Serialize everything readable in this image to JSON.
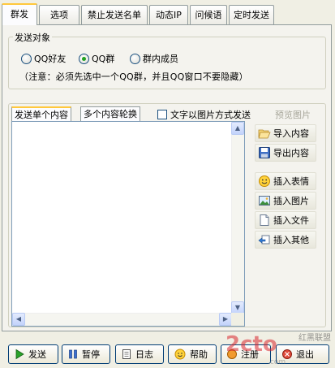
{
  "tabs": [
    "群发",
    "选项",
    "禁止发送名单",
    "动态IP",
    "问候语",
    "定时发送"
  ],
  "target_group": {
    "title": "发送对象",
    "options": [
      "QQ好友",
      "QQ群",
      "群内成员"
    ],
    "selected": "QQ群",
    "notice": "（注意：必须先选中一个QQ群，并且QQ窗口不要隐藏）"
  },
  "content": {
    "subtabs": [
      "发送单个内容",
      "多个内容轮换"
    ],
    "active_subtab": "发送单个内容",
    "image_mode_label": "文字以图片方式发送",
    "preview_label": "预览图片",
    "editor_text": ""
  },
  "side_buttons": [
    {
      "label": "导入内容",
      "icon": "folder-open-icon"
    },
    {
      "label": "导出内容",
      "icon": "floppy-disk-icon"
    },
    {
      "label": "插入表情",
      "icon": "smiley-icon"
    },
    {
      "label": "插入图片",
      "icon": "picture-icon"
    },
    {
      "label": "插入文件",
      "icon": "document-icon"
    },
    {
      "label": "插入其他",
      "icon": "insert-other-icon"
    }
  ],
  "bottom_buttons": [
    {
      "label": "发送",
      "icon": "play-icon"
    },
    {
      "label": "暂停",
      "icon": "pause-icon"
    },
    {
      "label": "日志",
      "icon": "log-icon"
    },
    {
      "label": "帮助",
      "icon": "help-icon"
    },
    {
      "label": "注册",
      "icon": "register-icon"
    },
    {
      "label": "退出",
      "icon": "exit-icon"
    }
  ],
  "colors": {
    "tab_highlight": "#ffc83c",
    "radio_on": "#21a121",
    "watermark_red": "#d8262d"
  }
}
